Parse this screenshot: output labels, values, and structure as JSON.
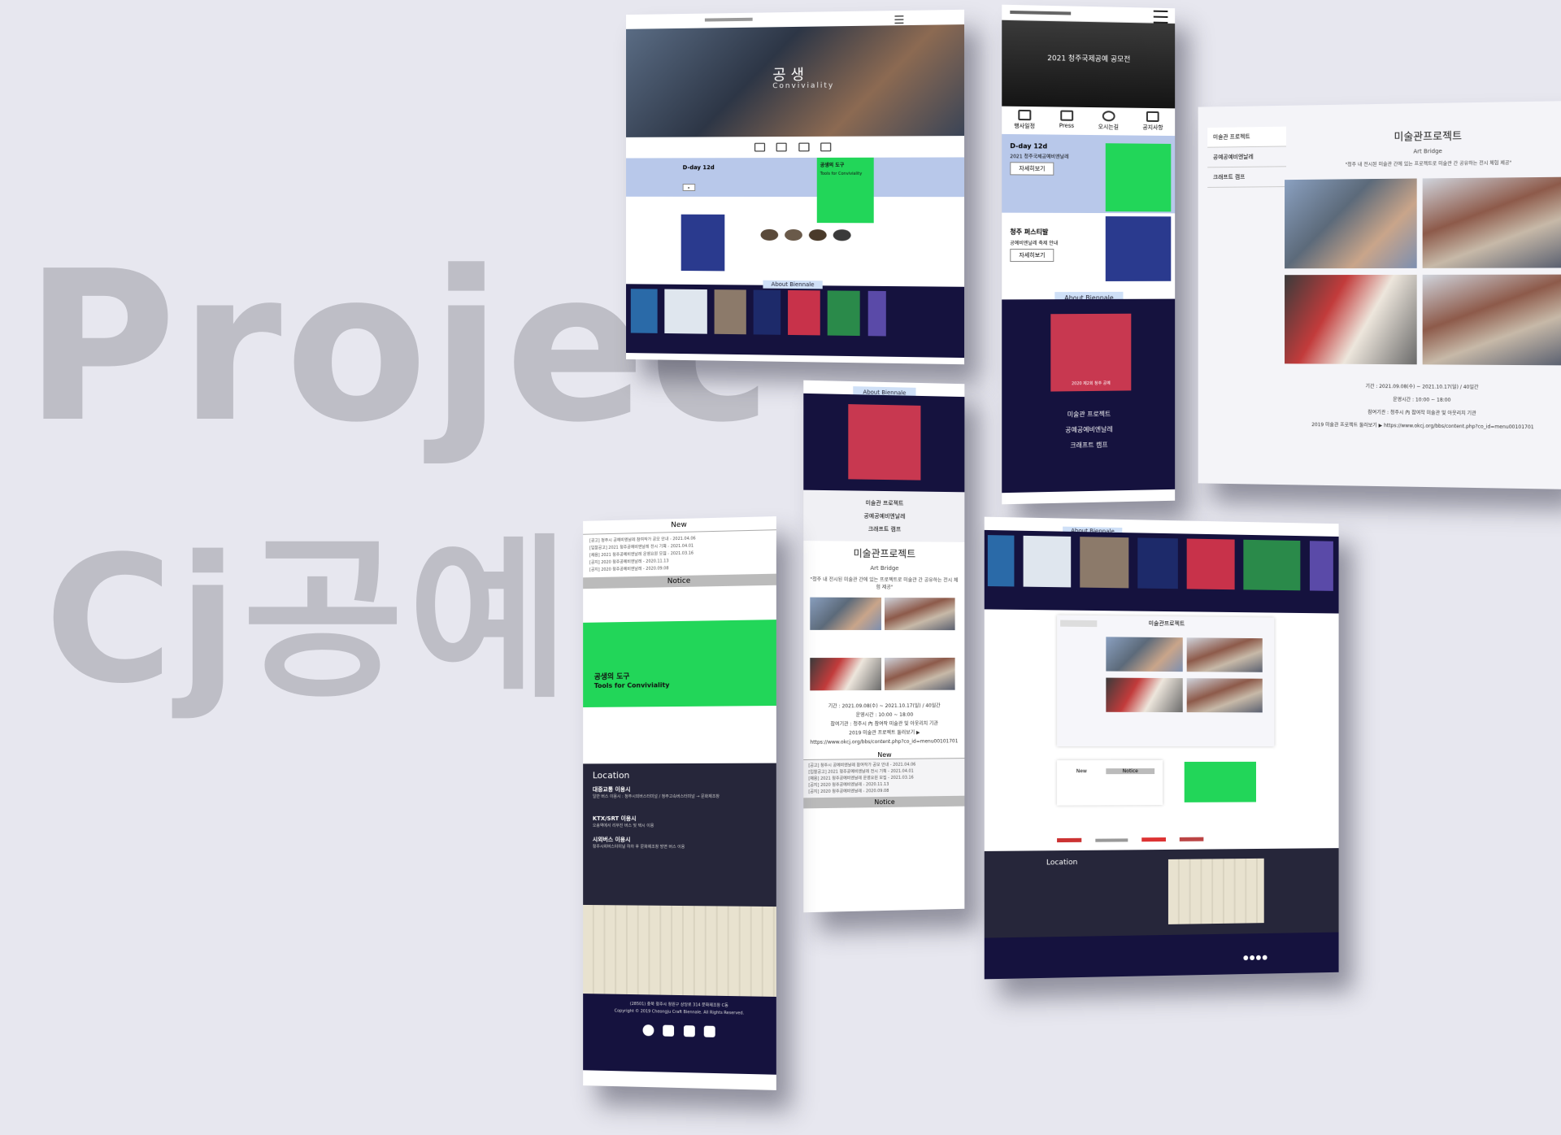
{
  "background_text": {
    "line1": "Projec",
    "line2": "Cj공예비"
  },
  "colors": {
    "navy": "#15123e",
    "green": "#22d659",
    "light_blue": "#cfe0f7",
    "dark": "#26263a"
  },
  "panel_main": {
    "hero_title": "공생",
    "hero_subtitle": "Conviviality",
    "dday": "D-day 12d",
    "poster_title": "공생의 도구",
    "poster_subtitle": "Tools for Conviviality",
    "section_pill": "About Biennale"
  },
  "panel_mobile": {
    "hero_title": "2021 청주국제공예 공모전",
    "nav": [
      "행사일정",
      "Press",
      "오시는길",
      "공지사항"
    ],
    "dday": "D-day 12d",
    "dday_text": "2021 청주국제공예비엔날레",
    "btn1": "자세히보기",
    "promo_title": "청주 퍼스티발",
    "promo_text": "공예비엔날레 축제 안내",
    "btn2": "자세히보기",
    "section_pill": "About Biennale",
    "poster_text": "2020 제2회 청주 공예",
    "links": [
      "미술관 프로젝트",
      "공예공예비엔날레",
      "크래프트 캠프"
    ]
  },
  "panel_detail": {
    "sidebar": [
      "미술관 프로젝트",
      "공예공예비엔날레",
      "크래프트 캠프"
    ],
    "title": "미술관프로젝트",
    "subtitle": "Art Bridge",
    "quote": "\"청주 내 전시된 미술관 간에 있는 프로젝트로 미술관 간 공유하는 전시 체험 제공\"",
    "info1": "기간 : 2021.09.08(수) ~ 2021.10.17(일) / 40일간",
    "info2": "운영시간 : 10:00 ~ 18:00",
    "info3": "참여기관 : 청주시 內 참여작 미술관 및 아웃리치 기관",
    "info4": "2019 미술관 프로젝트 둘러보기 ▶ https://www.okcj.org/bbs/content.php?co_id=menu00101701"
  },
  "panel_center": {
    "section_pill": "About Biennale",
    "links": [
      "미술관 프로젝트",
      "공예공예비엔날레",
      "크래프트 캠프"
    ],
    "title": "미술관프로젝트",
    "subtitle": "Art Bridge",
    "quote": "\"청주 내 전시된 미술관 간에 있는 프로젝트로 미술관 간 공유하는 전시 체험 제공\"",
    "info1": "기간 : 2021.09.08(수) ~ 2021.10.17(일) / 40일간",
    "info2": "운영시간 : 10:00 ~ 18:00",
    "info3": "참여기관 : 청주시 內 참여작 미술관 및 아웃리치 기관",
    "info4": "2019 미술관 프로젝트 둘러보기 ▶ https://www.okcj.org/bbs/content.php?co_id=menu00101701",
    "new_label": "New",
    "news": [
      "[공고] 청주시 공예비엔날레 참여작가 공모 안내 - 2021.04.06",
      "[입찰공고] 2021 청주공예비엔날레 전시 기획 - 2021.04.01",
      "[채용] 2021 청주공예비엔날레 운영요원 모집 - 2021.03.16",
      "[공지] 2020 청주공예비엔날레 - 2020.11.13",
      "[공지] 2020 청주공예비엔날레 - 2020.09.08"
    ],
    "notice_label": "Notice"
  },
  "panel_left": {
    "new_label": "New",
    "news": [
      "[공고] 청주시 공예비엔날레 참여작가 공모 안내 - 2021.04.06",
      "[입찰공고] 2021 청주공예비엔날레 전시 기획 - 2021.04.01",
      "[채용] 2021 청주공예비엔날레 운영요원 모집 - 2021.03.16",
      "[공지] 2020 청주공예비엔날레 - 2020.11.13",
      "[공지] 2020 청주공예비엔날레 - 2020.09.08"
    ],
    "notice_label": "Notice",
    "poster_title": "공생의 도구",
    "poster_subtitle": "Tools for Conviviality",
    "location_title": "Location",
    "loc1_title": "대중교통 이용시",
    "loc1_text": "일반 버스 이용시 : 청주시외버스터미널 / 청주고속버스터미널 → 문화제조창",
    "loc2_title": "KTX/SRT 이용시",
    "loc2_text": "오송역에서 리무진 버스 및 택시 이용",
    "loc3_title": "시외버스 이용시",
    "loc3_text": "청주시외버스터미널 하차 후 문화제조창 방면 버스 이용",
    "footer1": "(28501) 충북 청주시 청원구 상당로 314 문화제조창 C동",
    "footer2": "Copyright © 2019 Cheongju Craft Biennale. All Rights Reserved."
  },
  "panel_desktop": {
    "section_pill": "About Biennale",
    "detail_title": "미술관프로젝트",
    "new_label": "New",
    "notice_label": "Notice",
    "location_title": "Location"
  }
}
